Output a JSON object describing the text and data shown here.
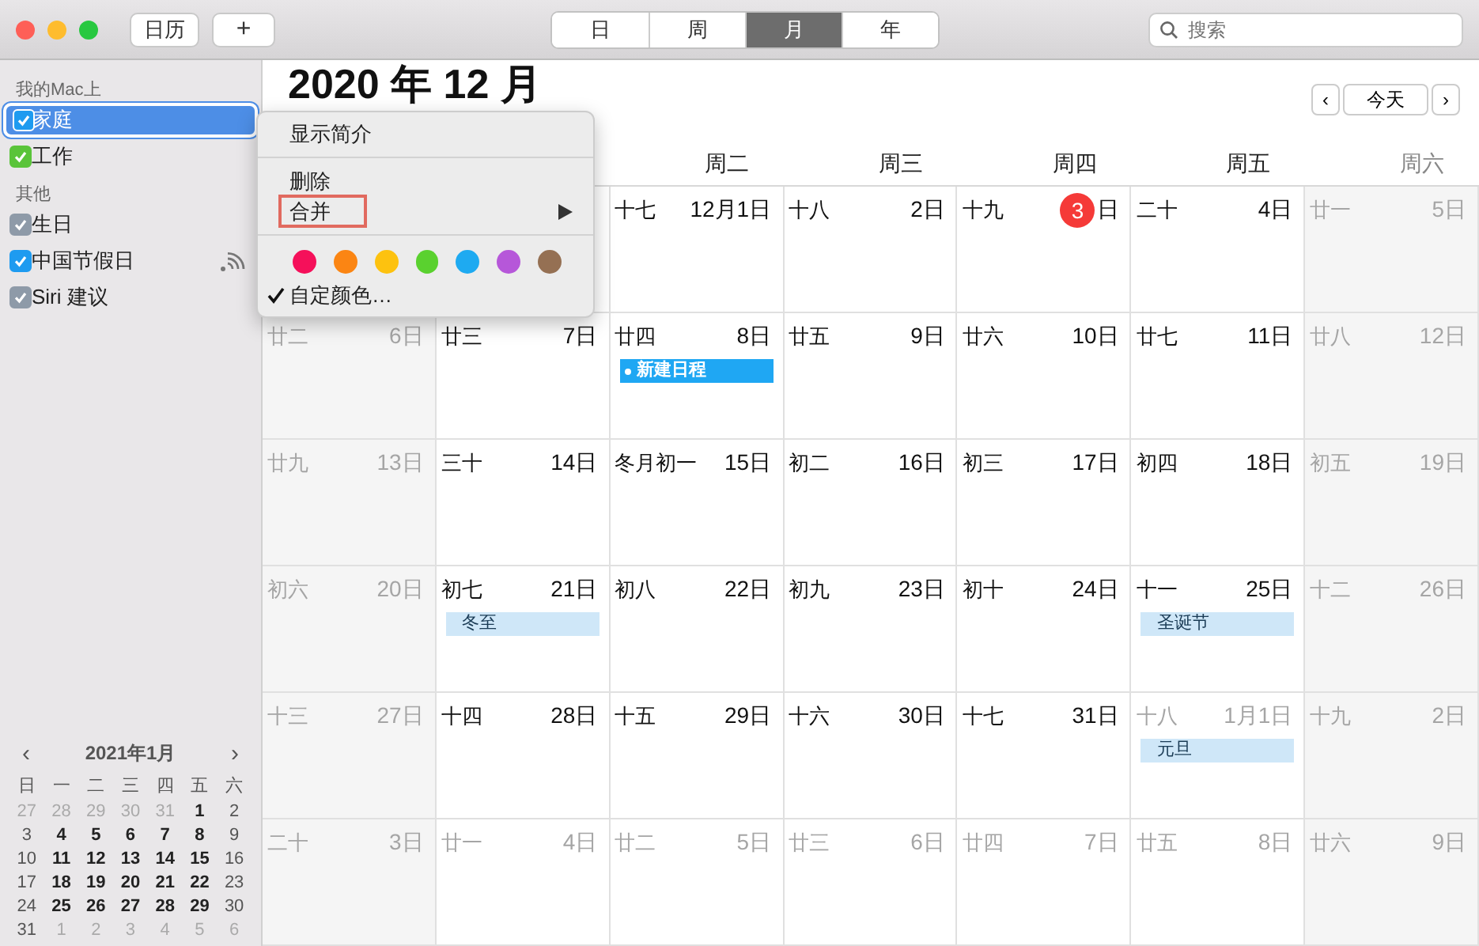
{
  "toolbar": {
    "calendars_button": "日历",
    "add_button": "+",
    "views": [
      {
        "label": "日",
        "selected": false
      },
      {
        "label": "周",
        "selected": false
      },
      {
        "label": "月",
        "selected": true
      },
      {
        "label": "年",
        "selected": false
      }
    ],
    "search": {
      "placeholder": "搜索"
    }
  },
  "sidebar": {
    "sections": [
      {
        "title": "我的Mac上",
        "items": [
          {
            "label": "家庭",
            "checked": true,
            "selected": true,
            "color": "#1e9bf0",
            "subscribed": false
          },
          {
            "label": "工作",
            "checked": true,
            "selected": false,
            "color": "#5ac43a",
            "subscribed": false
          }
        ]
      },
      {
        "title": "其他",
        "items": [
          {
            "label": "生日",
            "checked": true,
            "selected": false,
            "color": "#8e9aa8",
            "subscribed": false
          },
          {
            "label": "中国节假日",
            "checked": true,
            "selected": false,
            "color": "#1e9bf0",
            "subscribed": true
          },
          {
            "label": "Siri 建议",
            "checked": true,
            "selected": false,
            "color": "#8e9aa8",
            "subscribed": false
          }
        ]
      }
    ]
  },
  "mini_calendar": {
    "prev": "‹",
    "title": "2021年1月",
    "next": "›",
    "weekdays": [
      "日",
      "一",
      "二",
      "三",
      "四",
      "五",
      "六"
    ],
    "weeks": [
      [
        {
          "day": "27",
          "muted": true
        },
        {
          "day": "28",
          "muted": true
        },
        {
          "day": "29",
          "muted": true
        },
        {
          "day": "30",
          "muted": true
        },
        {
          "day": "31",
          "muted": true
        },
        {
          "day": "1",
          "muted": false
        },
        {
          "day": "2",
          "muted": false
        }
      ],
      [
        {
          "day": "3",
          "muted": false
        },
        {
          "day": "4",
          "muted": false
        },
        {
          "day": "5",
          "muted": false
        },
        {
          "day": "6",
          "muted": false
        },
        {
          "day": "7",
          "muted": false
        },
        {
          "day": "8",
          "muted": false
        },
        {
          "day": "9",
          "muted": false
        }
      ],
      [
        {
          "day": "10",
          "muted": false
        },
        {
          "day": "11",
          "muted": false
        },
        {
          "day": "12",
          "muted": false
        },
        {
          "day": "13",
          "muted": false
        },
        {
          "day": "14",
          "muted": false
        },
        {
          "day": "15",
          "muted": false
        },
        {
          "day": "16",
          "muted": false
        }
      ],
      [
        {
          "day": "17",
          "muted": false
        },
        {
          "day": "18",
          "muted": false
        },
        {
          "day": "19",
          "muted": false
        },
        {
          "day": "20",
          "muted": false
        },
        {
          "day": "21",
          "muted": false
        },
        {
          "day": "22",
          "muted": false
        },
        {
          "day": "23",
          "muted": false
        }
      ],
      [
        {
          "day": "24",
          "muted": false
        },
        {
          "day": "25",
          "muted": false
        },
        {
          "day": "26",
          "muted": false
        },
        {
          "day": "27",
          "muted": false
        },
        {
          "day": "28",
          "muted": false
        },
        {
          "day": "29",
          "muted": false
        },
        {
          "day": "30",
          "muted": false
        }
      ],
      [
        {
          "day": "31",
          "muted": false
        },
        {
          "day": "1",
          "muted": true
        },
        {
          "day": "2",
          "muted": true
        },
        {
          "day": "3",
          "muted": true
        },
        {
          "day": "4",
          "muted": true
        },
        {
          "day": "5",
          "muted": true
        },
        {
          "day": "6",
          "muted": true
        }
      ]
    ]
  },
  "month": {
    "title": "2020 年 12 月",
    "prev": "‹",
    "today": "今天",
    "next": "›",
    "weekdays": [
      "周二",
      "周三",
      "周四",
      "周五",
      "周六"
    ],
    "weeks": [
      [
        {
          "lunar": "十七",
          "day": "12月1日",
          "muted": false,
          "today": false
        },
        {
          "lunar": "十八",
          "day": "2日",
          "muted": false,
          "today": false
        },
        {
          "lunar": "十九",
          "day": "3",
          "day_suffix": "日",
          "muted": false,
          "today": true
        },
        {
          "lunar": "二十",
          "day": "4日",
          "muted": false,
          "today": false
        },
        {
          "lunar": "廿一",
          "day": "5日",
          "muted": true,
          "today": false
        }
      ],
      [
        {
          "lunar": "廿二",
          "day": "6日",
          "muted": true,
          "today": false
        },
        {
          "lunar": "廿三",
          "day": "7日",
          "muted": false,
          "today": false
        },
        {
          "lunar": "廿四",
          "day": "8日",
          "muted": false,
          "today": false,
          "events": [
            {
              "title": "新建日程",
              "selected": true
            }
          ]
        },
        {
          "lunar": "廿五",
          "day": "9日",
          "muted": false,
          "today": false
        },
        {
          "lunar": "廿六",
          "day": "10日",
          "muted": false,
          "today": false
        },
        {
          "lunar": "廿七",
          "day": "11日",
          "muted": false,
          "today": false
        },
        {
          "lunar": "廿八",
          "day": "12日",
          "muted": true,
          "today": false
        }
      ],
      [
        {
          "lunar": "廿九",
          "day": "13日",
          "muted": true,
          "today": false
        },
        {
          "lunar": "三十",
          "day": "14日",
          "muted": false,
          "today": false
        },
        {
          "lunar": "冬月初一",
          "day": "15日",
          "muted": false,
          "today": false
        },
        {
          "lunar": "初二",
          "day": "16日",
          "muted": false,
          "today": false
        },
        {
          "lunar": "初三",
          "day": "17日",
          "muted": false,
          "today": false
        },
        {
          "lunar": "初四",
          "day": "18日",
          "muted": false,
          "today": false
        },
        {
          "lunar": "初五",
          "day": "19日",
          "muted": true,
          "today": false
        }
      ],
      [
        {
          "lunar": "初六",
          "day": "20日",
          "muted": true,
          "today": false
        },
        {
          "lunar": "初七",
          "day": "21日",
          "muted": false,
          "today": false,
          "events": [
            {
              "title": "冬至",
              "selected": false
            }
          ]
        },
        {
          "lunar": "初八",
          "day": "22日",
          "muted": false,
          "today": false
        },
        {
          "lunar": "初九",
          "day": "23日",
          "muted": false,
          "today": false
        },
        {
          "lunar": "初十",
          "day": "24日",
          "muted": false,
          "today": false
        },
        {
          "lunar": "十一",
          "day": "25日",
          "muted": false,
          "today": false,
          "events": [
            {
              "title": "圣诞节",
              "selected": false
            }
          ]
        },
        {
          "lunar": "十二",
          "day": "26日",
          "muted": true,
          "today": false
        }
      ],
      [
        {
          "lunar": "十三",
          "day": "27日",
          "muted": true,
          "today": false
        },
        {
          "lunar": "十四",
          "day": "28日",
          "muted": false,
          "today": false
        },
        {
          "lunar": "十五",
          "day": "29日",
          "muted": false,
          "today": false
        },
        {
          "lunar": "十六",
          "day": "30日",
          "muted": false,
          "today": false
        },
        {
          "lunar": "十七",
          "day": "31日",
          "muted": false,
          "today": false
        },
        {
          "lunar": "十八",
          "day": "1月1日",
          "muted": true,
          "today": false,
          "events": [
            {
              "title": "元旦",
              "selected": false
            }
          ]
        },
        {
          "lunar": "十九",
          "day": "2日",
          "muted": true,
          "today": false
        }
      ],
      [
        {
          "lunar": "二十",
          "day": "3日",
          "muted": true,
          "today": false
        },
        {
          "lunar": "廿一",
          "day": "4日",
          "muted": true,
          "today": false
        },
        {
          "lunar": "廿二",
          "day": "5日",
          "muted": true,
          "today": false
        },
        {
          "lunar": "廿三",
          "day": "6日",
          "muted": true,
          "today": false
        },
        {
          "lunar": "廿四",
          "day": "7日",
          "muted": true,
          "today": false
        },
        {
          "lunar": "廿五",
          "day": "8日",
          "muted": true,
          "today": false
        },
        {
          "lunar": "廿六",
          "day": "9日",
          "muted": true,
          "today": false
        }
      ]
    ]
  },
  "context_menu": {
    "groups": [
      [
        {
          "kind": "item",
          "label": "显示简介",
          "submenu": false,
          "outlined": false
        }
      ],
      [
        {
          "kind": "item",
          "label": "删除",
          "submenu": false,
          "outlined": false
        },
        {
          "kind": "item",
          "label": "合并",
          "submenu": true,
          "outlined": true
        }
      ],
      [
        {
          "kind": "colors",
          "swatches": [
            {
              "color": "#f5105a"
            },
            {
              "color": "#fb8513"
            },
            {
              "color": "#fdc20f"
            },
            {
              "color": "#5ad12f"
            },
            {
              "color": "#1eaaf1"
            },
            {
              "color": "#b657d9"
            },
            {
              "color": "#957053"
            }
          ]
        },
        {
          "kind": "check",
          "label": "自定颜色…",
          "checked": true
        }
      ]
    ]
  }
}
